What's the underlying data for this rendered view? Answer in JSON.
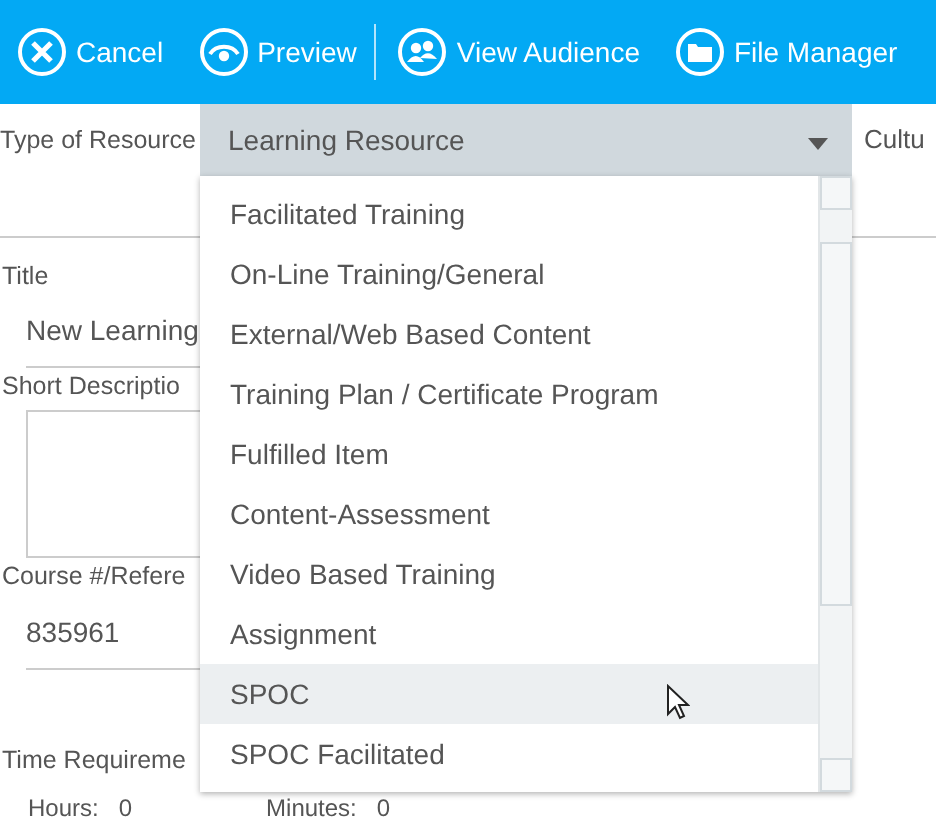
{
  "toolbar": {
    "buttons": [
      {
        "kind": "cancel",
        "label": "Cancel",
        "divider_after": false
      },
      {
        "kind": "preview",
        "label": "Preview",
        "divider_after": true
      },
      {
        "kind": "audience",
        "label": "View Audience",
        "divider_after": false
      },
      {
        "kind": "files",
        "label": "File Manager",
        "divider_after": false
      }
    ]
  },
  "form": {
    "type_label": "Type of Resource",
    "culture_label": "Cultu",
    "title_label": "Title",
    "title_value": "New Learning",
    "short_description_label": "Short Descriptio",
    "course_label": "Course #/Refere",
    "course_value": "835961",
    "time_label": "Time Requireme",
    "hours_label": "Hours:",
    "hours_value": "0",
    "minutes_label": "Minutes:",
    "minutes_value": "0"
  },
  "dropdown": {
    "value": "Learning Resource",
    "expanded": true,
    "options": [
      {
        "label": "Facilitated Training",
        "highlighted": false
      },
      {
        "label": "On-Line Training/General",
        "highlighted": false
      },
      {
        "label": "External/Web Based Content",
        "highlighted": false
      },
      {
        "label": "Training Plan / Certificate Program",
        "highlighted": false
      },
      {
        "label": "Fulfilled Item",
        "highlighted": false
      },
      {
        "label": "Content-Assessment",
        "highlighted": false
      },
      {
        "label": "Video Based Training",
        "highlighted": false
      },
      {
        "label": "Assignment",
        "highlighted": false
      },
      {
        "label": "SPOC",
        "highlighted": true
      },
      {
        "label": "SPOC Facilitated",
        "highlighted": false
      }
    ]
  }
}
